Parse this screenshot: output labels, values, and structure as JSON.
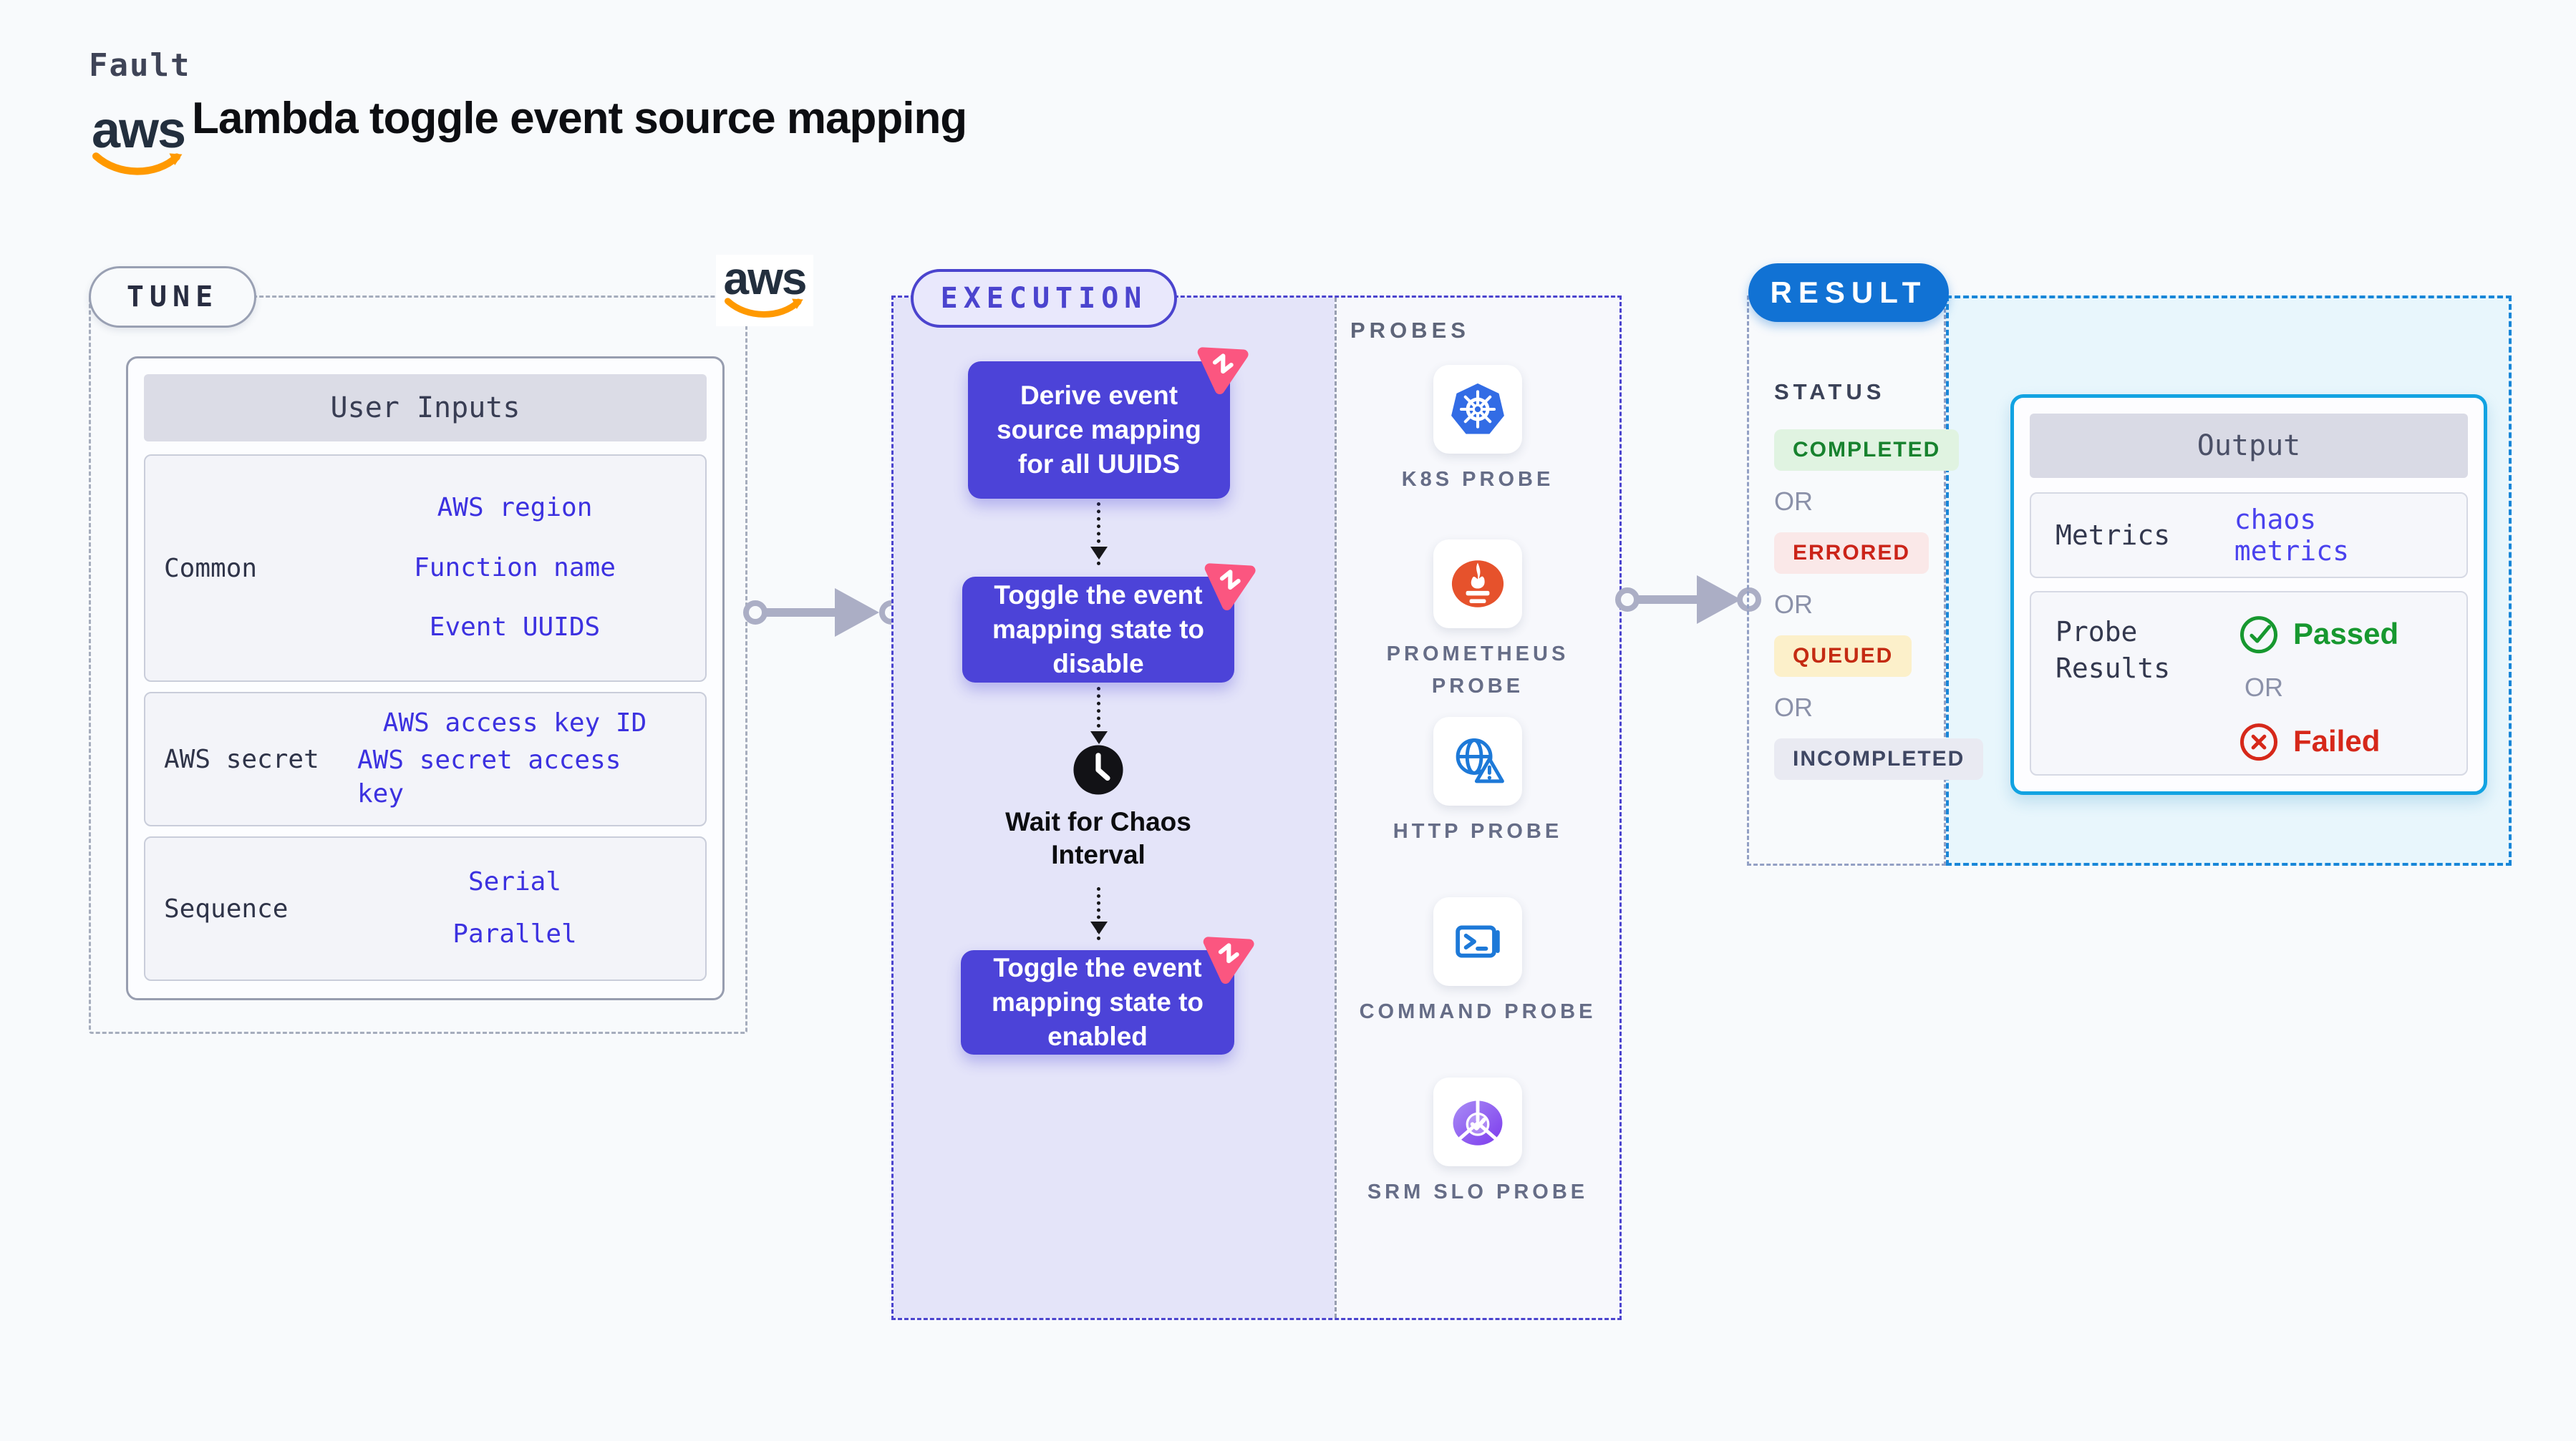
{
  "header": {
    "fault_label": "Fault",
    "title": "Lambda toggle event source mapping",
    "aws_logo_text": "aws"
  },
  "tune": {
    "pill_label": "TUNE",
    "table_header": "User Inputs",
    "rows": [
      {
        "label": "Common",
        "links": [
          "AWS region",
          "Function name",
          "Event UUIDS"
        ]
      },
      {
        "label": "AWS secret",
        "links": [
          "AWS access key ID",
          "AWS secret access key"
        ]
      },
      {
        "label": "Sequence",
        "links": [
          "Serial",
          "Parallel"
        ]
      }
    ]
  },
  "execution": {
    "pill_label": "EXECUTION",
    "steps": [
      "Derive event source mapping for all UUIDS",
      "Toggle the event mapping state to disable",
      "Toggle the event mapping state to enabled"
    ],
    "wait_label": "Wait for Chaos Interval"
  },
  "probes": {
    "header": "PROBES",
    "items": [
      {
        "label": "K8S PROBE",
        "icon": "kubernetes-icon"
      },
      {
        "label": "PROMETHEUS PROBE",
        "icon": "prometheus-icon"
      },
      {
        "label": "HTTP PROBE",
        "icon": "http-globe-warning-icon"
      },
      {
        "label": "COMMAND PROBE",
        "icon": "terminal-icon"
      },
      {
        "label": "SRM SLO PROBE",
        "icon": "slo-pie-check-icon"
      }
    ]
  },
  "result": {
    "pill_label": "RESULT",
    "status_label": "STATUS",
    "or_label": "OR",
    "badges": [
      {
        "label": "COMPLETED",
        "fg": "#17822e",
        "bg": "#e0f3e1"
      },
      {
        "label": "ERRORED",
        "fg": "#cb2419",
        "bg": "#fae8e8"
      },
      {
        "label": "QUEUED",
        "fg": "#c42b12",
        "bg": "#fcf0ca"
      },
      {
        "label": "INCOMPLETED",
        "fg": "#3f4763",
        "bg": "#e9eaf2"
      }
    ],
    "output": {
      "header": "Output",
      "metrics_label": "Metrics",
      "metrics_value": "chaos metrics",
      "probe_results_label": "Probe Results",
      "passed_label": "Passed",
      "failed_label": "Failed"
    }
  },
  "colors": {
    "page_background": "#f8fafc",
    "indigo_accent": "#4b44ce",
    "step_box": "#4c43d8",
    "purple_panel": "#e4e4f9",
    "result_blue": "#1172d4",
    "cyan_border": "#12a3e2",
    "cyan_background": "#e8f6fc",
    "link_blue": "#3c31e0",
    "aws_orange": "#ff9900",
    "fault_icon_pink": "#fb5680",
    "passed_green": "#17982f",
    "failed_red": "#d6281a"
  }
}
